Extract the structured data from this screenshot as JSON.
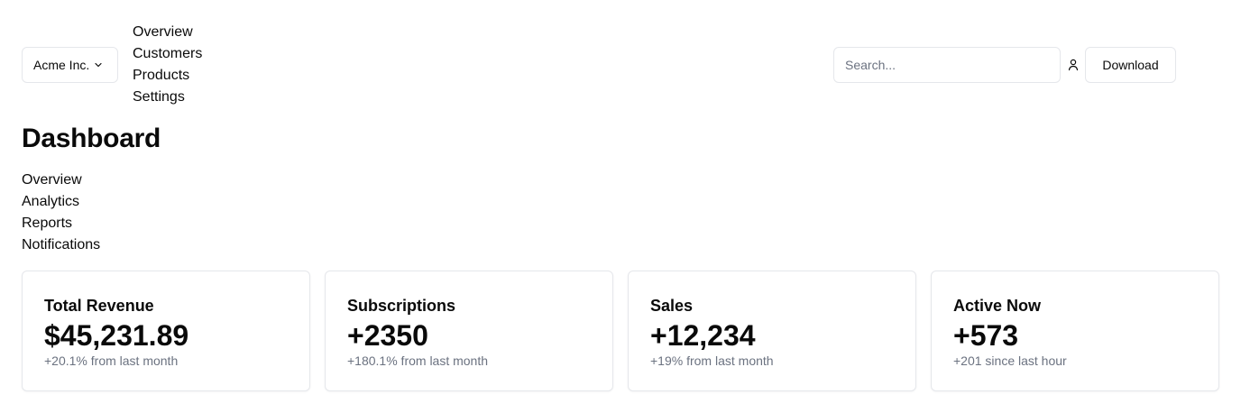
{
  "header": {
    "team_switcher": {
      "label": "Acme Inc.",
      "icon": "chevron-down-icon"
    },
    "main_nav": [
      "Overview",
      "Customers",
      "Products",
      "Settings"
    ],
    "search": {
      "placeholder": "Search...",
      "value": ""
    },
    "user_icon": "user-icon",
    "download_label": "Download"
  },
  "page": {
    "title": "Dashboard",
    "sub_nav": [
      "Overview",
      "Analytics",
      "Reports",
      "Notifications"
    ]
  },
  "cards": [
    {
      "title": "Total Revenue",
      "value": "$45,231.89",
      "note": "+20.1% from last month"
    },
    {
      "title": "Subscriptions",
      "value": "+2350",
      "note": "+180.1% from last month"
    },
    {
      "title": "Sales",
      "value": "+12,234",
      "note": "+19% from last month"
    },
    {
      "title": "Active Now",
      "value": "+573",
      "note": "+201 since last hour"
    }
  ],
  "colors": {
    "text": "#0a0a0a",
    "muted": "#6b7280",
    "border": "#e5e7eb",
    "background": "#ffffff"
  }
}
